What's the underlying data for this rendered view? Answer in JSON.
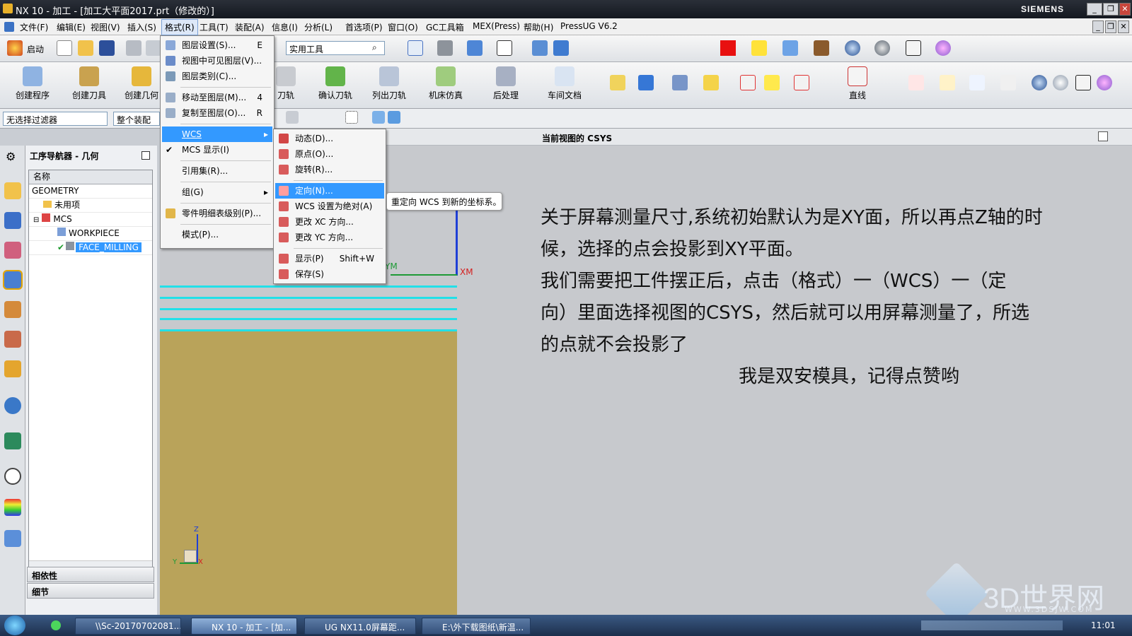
{
  "window": {
    "title": "NX 10 - 加工 - [加工大平面2017.prt（修改的）]",
    "brand": "SIEMENS"
  },
  "menubar": [
    "文件(F)",
    "编辑(E)",
    "视图(V)",
    "插入(S)",
    "格式(R)",
    "工具(T)",
    "装配(A)",
    "信息(I)",
    "分析(L)",
    "首选项(P)",
    "窗口(O)",
    "GC工具箱",
    "MEX(Press)",
    "帮助(H)",
    "PressUG V6.2"
  ],
  "toolbar": {
    "start": "启动",
    "utility_field": "实用工具"
  },
  "ribbon": {
    "buttons": [
      "创建程序",
      "创建刀具",
      "创建几何",
      "刀轨",
      "确认刀轨",
      "列出刀轨",
      "机床仿真",
      "后处理",
      "车间文档",
      "直线"
    ]
  },
  "filter": {
    "selection": "无选择过滤器",
    "scope": "整个装配"
  },
  "view_title": "当前视图的 CSYS",
  "navigator": {
    "title": "工序导航器 - 几何",
    "column": "名称",
    "rows": [
      "GEOMETRY",
      "未用项",
      "MCS",
      "WORKPIECE",
      "FACE_MILLING"
    ],
    "panes": [
      "相依性",
      "细节"
    ]
  },
  "format_menu": [
    {
      "label": "图层设置(S)...",
      "shortcut": "E"
    },
    {
      "label": "视图中可见图层(V)...",
      "shortcut": ""
    },
    {
      "label": "图层类别(C)...",
      "shortcut": ""
    },
    {
      "label": "移动至图层(M)...",
      "shortcut": "4"
    },
    {
      "label": "复制至图层(O)...",
      "shortcut": "R"
    },
    {
      "label": "WCS",
      "shortcut": ""
    },
    {
      "label": "MCS 显示(I)",
      "shortcut": ""
    },
    {
      "label": "引用集(R)...",
      "shortcut": ""
    },
    {
      "label": "组(G)",
      "shortcut": ""
    },
    {
      "label": "零件明细表级别(P)...",
      "shortcut": ""
    },
    {
      "label": "模式(P)...",
      "shortcut": ""
    }
  ],
  "wcs_menu": [
    {
      "label": "动态(D)...",
      "shortcut": ""
    },
    {
      "label": "原点(O)...",
      "shortcut": ""
    },
    {
      "label": "旋转(R)...",
      "shortcut": ""
    },
    {
      "label": "定向(N)...",
      "shortcut": ""
    },
    {
      "label": "WCS 设置为绝对(A)",
      "shortcut": ""
    },
    {
      "label": "更改 XC 方向...",
      "shortcut": ""
    },
    {
      "label": "更改 YC 方向...",
      "shortcut": ""
    },
    {
      "label": "显示(P)",
      "shortcut": "Shift+W"
    },
    {
      "label": "保存(S)",
      "shortcut": ""
    }
  ],
  "tooltip": "重定向 WCS 到新的坐标系。",
  "annotation": {
    "lines": [
      "关于屏幕测量尺寸,系统初始默认为是XY面，所以再点Z轴的时",
      "候，选择的点会投影到XY平面。",
      "我们需要把工件摆正后，点击（格式）一（WCS）一（定",
      "向）里面选择视图的CSYS，然后就可以用屏幕测量了，所选",
      "的点就不会投影了"
    ],
    "signature": "我是双安模具，记得点赞哟"
  },
  "axes": {
    "z": "Z",
    "y": "Y",
    "x": "X",
    "ym": "YM",
    "xm": "XM"
  },
  "watermark": {
    "text": "3D世界网",
    "url": "WWW.3DSJW.COM"
  },
  "taskbar": {
    "items": [
      "\\\\Sc-20170702081...",
      "NX 10 - 加工 - [加...",
      "UG NX11.0屏幕距...",
      "E:\\外下载图纸\\新温..."
    ],
    "clock": "11:01"
  }
}
